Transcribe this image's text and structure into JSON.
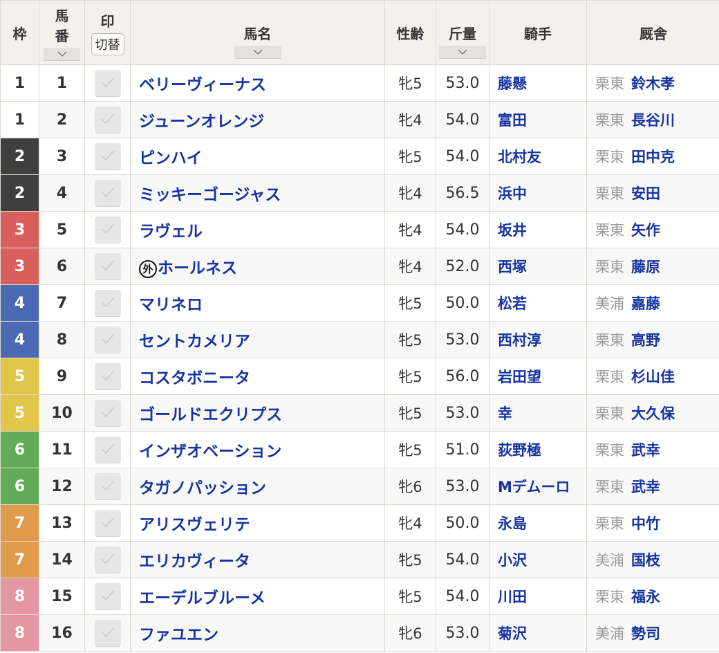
{
  "header": {
    "waku": "枠",
    "umaban_line1": "馬",
    "umaban_line2": "番",
    "mark": "印",
    "mark_toggle": "切替",
    "name": "馬名",
    "sexage": "性齢",
    "weight": "斤量",
    "jockey": "騎手",
    "trainer": "厩舎"
  },
  "waku_colors": {
    "1": {
      "bg": "#ffffff",
      "fg": "#333333"
    },
    "2": {
      "bg": "#3f3f3f",
      "fg": "#ffffff"
    },
    "3": {
      "bg": "#d95f5c",
      "fg": "#ffffff"
    },
    "4": {
      "bg": "#4a6ab4",
      "fg": "#ffffff"
    },
    "5": {
      "bg": "#e2c64a",
      "fg": "#ffffff"
    },
    "6": {
      "bg": "#62ac57",
      "fg": "#ffffff"
    },
    "7": {
      "bg": "#e29a4b",
      "fg": "#ffffff"
    },
    "8": {
      "bg": "#e496a1",
      "fg": "#ffffff"
    }
  },
  "rows": [
    {
      "waku": "1",
      "umaban": "1",
      "foreign": false,
      "name": "ベリーヴィーナス",
      "sexage": "牝5",
      "weight": "53.0",
      "jockey": "藤懸",
      "area": "栗東",
      "trainer": "鈴木孝"
    },
    {
      "waku": "1",
      "umaban": "2",
      "foreign": false,
      "name": "ジューンオレンジ",
      "sexage": "牝4",
      "weight": "54.0",
      "jockey": "富田",
      "area": "栗東",
      "trainer": "長谷川"
    },
    {
      "waku": "2",
      "umaban": "3",
      "foreign": false,
      "name": "ピンハイ",
      "sexage": "牝5",
      "weight": "54.0",
      "jockey": "北村友",
      "area": "栗東",
      "trainer": "田中克"
    },
    {
      "waku": "2",
      "umaban": "4",
      "foreign": false,
      "name": "ミッキーゴージャス",
      "sexage": "牝4",
      "weight": "56.5",
      "jockey": "浜中",
      "area": "栗東",
      "trainer": "安田"
    },
    {
      "waku": "3",
      "umaban": "5",
      "foreign": false,
      "name": "ラヴェル",
      "sexage": "牝4",
      "weight": "54.0",
      "jockey": "坂井",
      "area": "栗東",
      "trainer": "矢作"
    },
    {
      "waku": "3",
      "umaban": "6",
      "foreign": true,
      "foreign_mark": "外",
      "name": "ホールネス",
      "sexage": "牝4",
      "weight": "52.0",
      "jockey": "西塚",
      "area": "栗東",
      "trainer": "藤原"
    },
    {
      "waku": "4",
      "umaban": "7",
      "foreign": false,
      "name": "マリネロ",
      "sexage": "牝5",
      "weight": "50.0",
      "jockey": "松若",
      "area": "美浦",
      "trainer": "嘉藤"
    },
    {
      "waku": "4",
      "umaban": "8",
      "foreign": false,
      "name": "セントカメリア",
      "sexage": "牝5",
      "weight": "53.0",
      "jockey": "西村淳",
      "area": "栗東",
      "trainer": "高野"
    },
    {
      "waku": "5",
      "umaban": "9",
      "foreign": false,
      "name": "コスタボニータ",
      "sexage": "牝5",
      "weight": "56.0",
      "jockey": "岩田望",
      "area": "栗東",
      "trainer": "杉山佳"
    },
    {
      "waku": "5",
      "umaban": "10",
      "foreign": false,
      "name": "ゴールドエクリプス",
      "sexage": "牝5",
      "weight": "53.0",
      "jockey": "幸",
      "area": "栗東",
      "trainer": "大久保"
    },
    {
      "waku": "6",
      "umaban": "11",
      "foreign": false,
      "name": "インザオベーション",
      "sexage": "牝5",
      "weight": "51.0",
      "jockey": "荻野極",
      "area": "栗東",
      "trainer": "武幸"
    },
    {
      "waku": "6",
      "umaban": "12",
      "foreign": false,
      "name": "タガノパッション",
      "sexage": "牝6",
      "weight": "53.0",
      "jockey": "Mデムーロ",
      "area": "栗東",
      "trainer": "武幸"
    },
    {
      "waku": "7",
      "umaban": "13",
      "foreign": false,
      "name": "アリスヴェリテ",
      "sexage": "牝4",
      "weight": "50.0",
      "jockey": "永島",
      "area": "栗東",
      "trainer": "中竹"
    },
    {
      "waku": "7",
      "umaban": "14",
      "foreign": false,
      "name": "エリカヴィータ",
      "sexage": "牝5",
      "weight": "54.0",
      "jockey": "小沢",
      "area": "美浦",
      "trainer": "国枝"
    },
    {
      "waku": "8",
      "umaban": "15",
      "foreign": false,
      "name": "エーデルブルーメ",
      "sexage": "牝5",
      "weight": "54.0",
      "jockey": "川田",
      "area": "栗東",
      "trainer": "福永"
    },
    {
      "waku": "8",
      "umaban": "16",
      "foreign": false,
      "name": "ファユエン",
      "sexage": "牝6",
      "weight": "53.0",
      "jockey": "菊沢",
      "area": "美浦",
      "trainer": "勢司"
    }
  ]
}
